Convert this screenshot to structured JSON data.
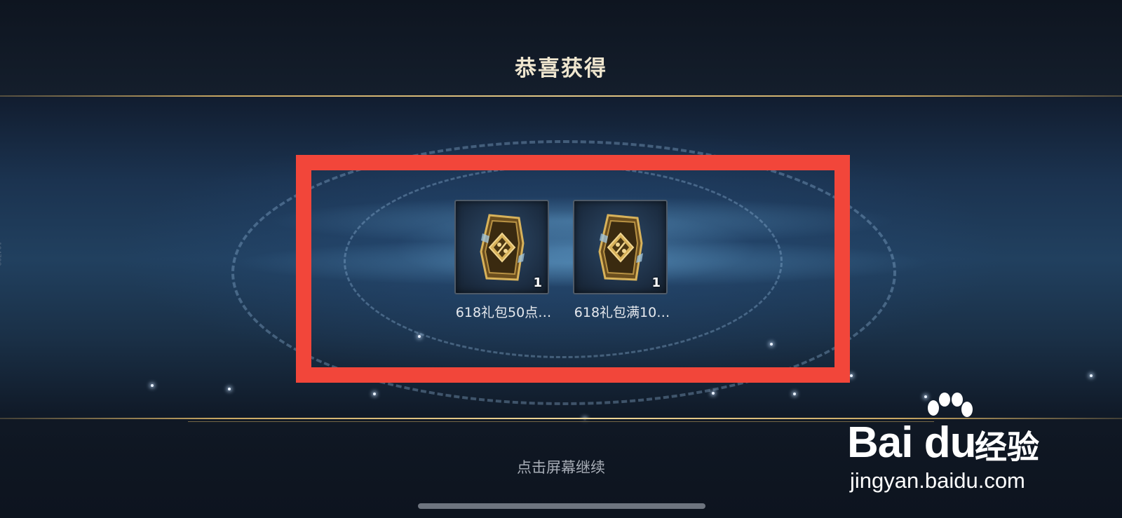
{
  "dialog": {
    "title": "恭喜获得",
    "continue_hint": "点击屏幕继续"
  },
  "rewards": [
    {
      "label": "618礼包50点…",
      "count": "1",
      "icon": "discount-coupon-icon"
    },
    {
      "label": "618礼包满10…",
      "count": "1",
      "icon": "discount-coupon-icon"
    }
  ],
  "side_text": "104708",
  "watermark": {
    "logo": "Bai du",
    "product": "经验",
    "url": "jingyan.baidu.com"
  },
  "colors": {
    "highlight": "#f2463a",
    "gold": "#c9a863",
    "title": "#efe6cf"
  }
}
